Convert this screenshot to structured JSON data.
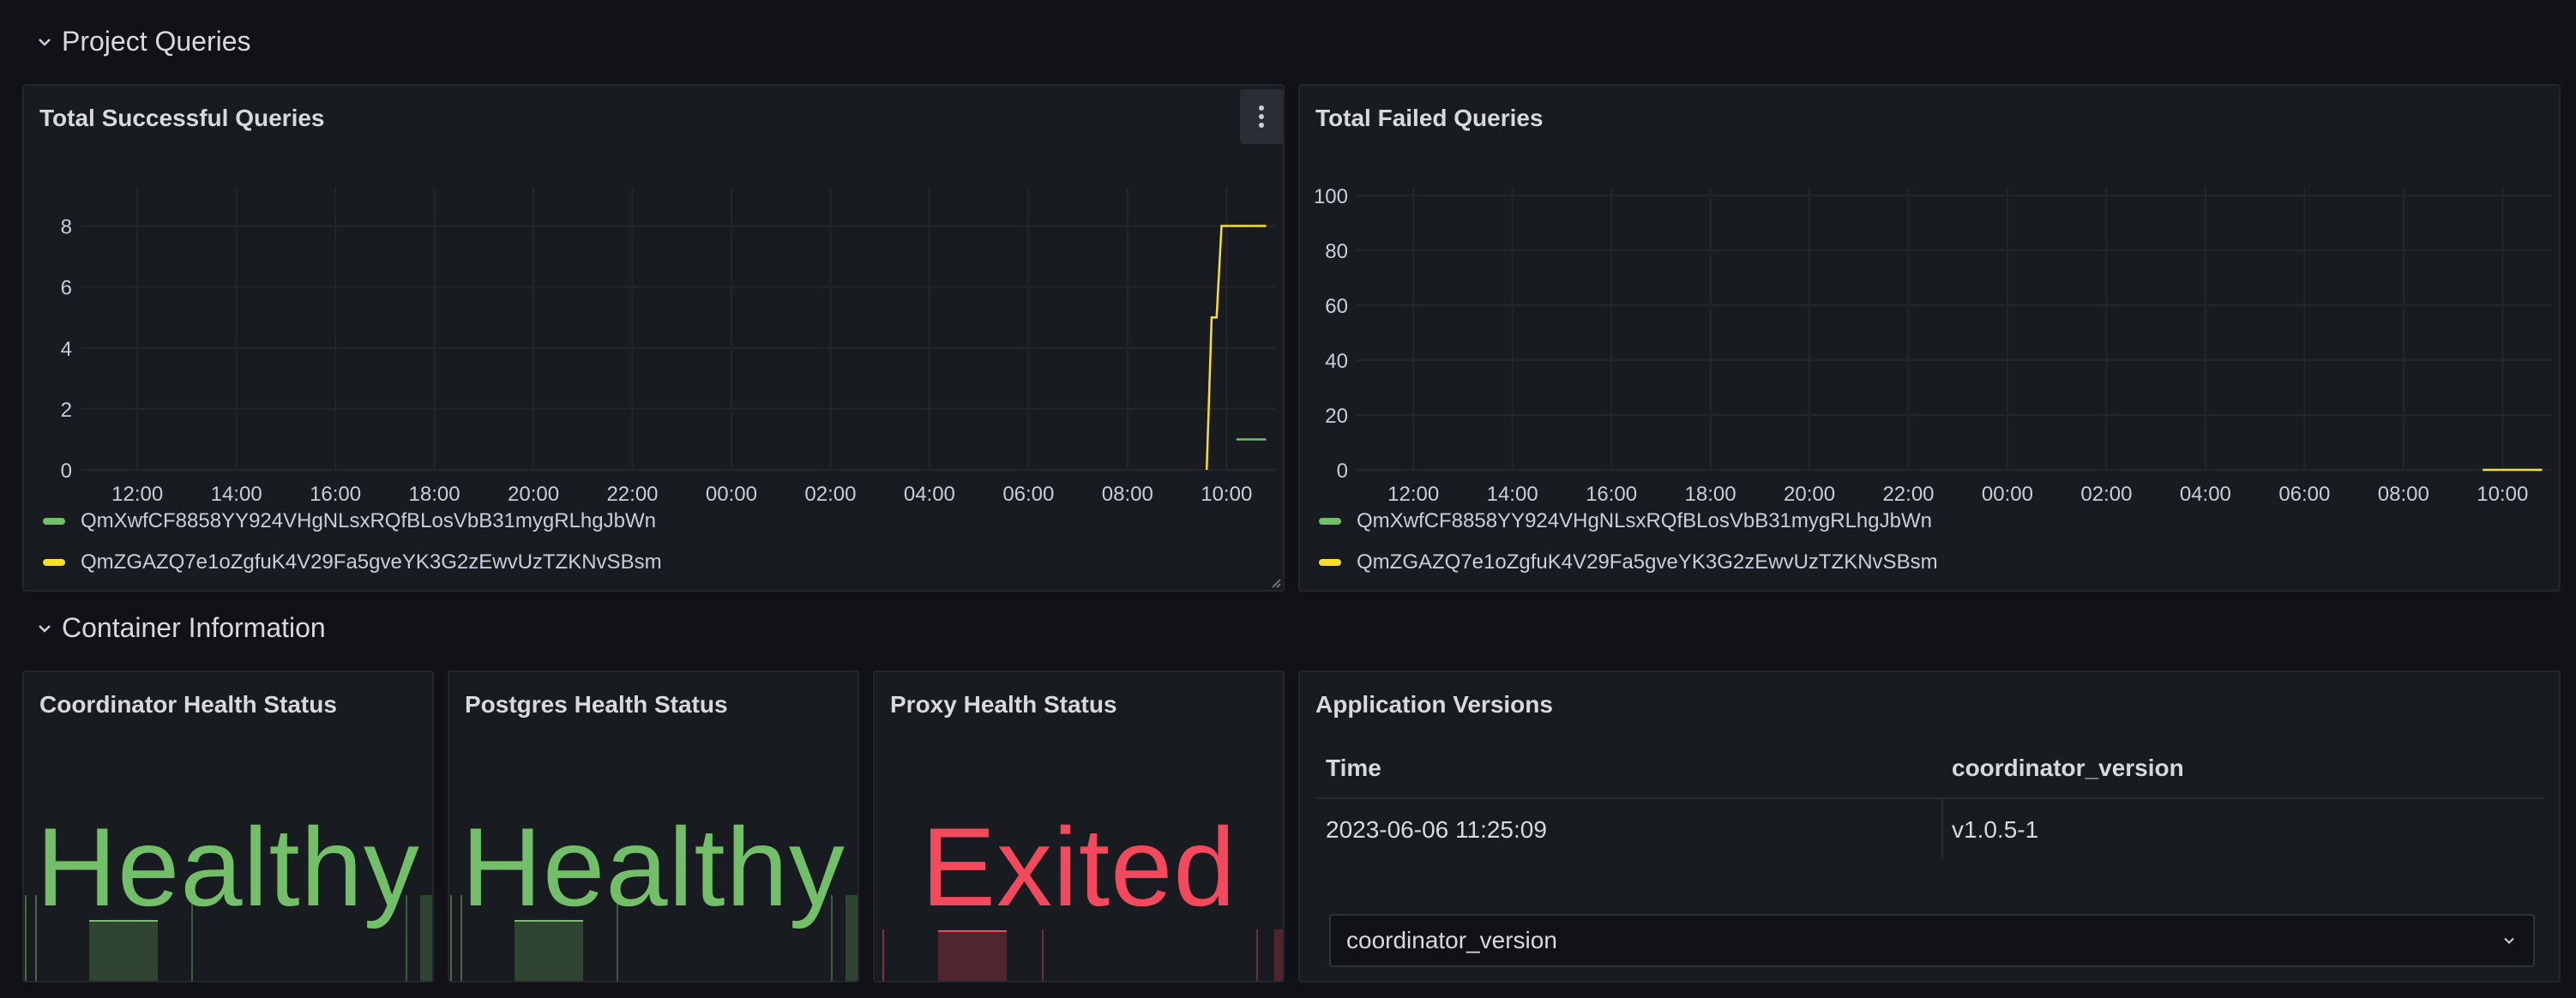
{
  "rows": {
    "project_queries": "Project Queries",
    "container_information": "Container Information"
  },
  "colors": {
    "green": "#73bf69",
    "yellow": "#fade2a",
    "red": "#f2495c"
  },
  "panels": {
    "successful": {
      "title": "Total Successful Queries",
      "legend": [
        {
          "name": "QmXwfCF8858YY924VHgNLsxRQfBLosVbB31mygRLhgJbWn",
          "color": "#73bf69"
        },
        {
          "name": "QmZGAZQ7e1oZgfuK4V29Fa5gveYK3G2zEwvUzTZKNvSBsm",
          "color": "#fade2a"
        }
      ]
    },
    "failed": {
      "title": "Total Failed Queries",
      "legend": [
        {
          "name": "QmXwfCF8858YY924VHgNLsxRQfBLosVbB31mygRLhgJbWn",
          "color": "#73bf69"
        },
        {
          "name": "QmZGAZQ7e1oZgfuK4V29Fa5gveYK3G2zEwvUzTZKNvSBsm",
          "color": "#fade2a"
        }
      ]
    },
    "coordinator": {
      "title": "Coordinator Health Status",
      "value": "Healthy"
    },
    "postgres": {
      "title": "Postgres Health Status",
      "value": "Healthy"
    },
    "proxy": {
      "title": "Proxy Health Status",
      "value": "Exited"
    },
    "versions": {
      "title": "Application Versions",
      "columns": [
        "Time",
        "coordinator_version"
      ],
      "rows": [
        [
          "2023-06-06 11:25:09",
          "v1.0.5-1"
        ]
      ],
      "select_value": "coordinator_version"
    }
  },
  "chart_data": [
    {
      "type": "line",
      "title": "Total Successful Queries",
      "x_ticks": [
        "12:00",
        "14:00",
        "16:00",
        "18:00",
        "20:00",
        "22:00",
        "00:00",
        "02:00",
        "04:00",
        "06:00",
        "08:00",
        "10:00"
      ],
      "y_ticks": [
        0,
        2,
        4,
        6,
        8
      ],
      "ylim": [
        0,
        9
      ],
      "grid": true,
      "legend": "bottom",
      "series": [
        {
          "name": "QmXwfCF8858YY924VHgNLsxRQfBLosVbB31mygRLhgJbWn",
          "color": "#73bf69",
          "x": [
            11.1,
            11.4
          ],
          "y": [
            1,
            1
          ]
        },
        {
          "name": "QmZGAZQ7e1oZgfuK4V29Fa5gveYK3G2zEwvUzTZKNvSBsm",
          "color": "#fade2a",
          "x": [
            10.8,
            10.85,
            10.9,
            10.95,
            11.0,
            11.4
          ],
          "y": [
            0,
            5,
            5,
            8,
            8,
            8
          ]
        }
      ]
    },
    {
      "type": "line",
      "title": "Total Failed Queries",
      "x_ticks": [
        "12:00",
        "14:00",
        "16:00",
        "18:00",
        "20:00",
        "22:00",
        "00:00",
        "02:00",
        "04:00",
        "06:00",
        "08:00",
        "10:00"
      ],
      "y_ticks": [
        0,
        20,
        40,
        60,
        80,
        100
      ],
      "ylim": [
        0,
        100
      ],
      "grid": true,
      "legend": "bottom",
      "series": [
        {
          "name": "QmZGAZQ7e1oZgfuK4V29Fa5gveYK3G2zEwvUzTZKNvSBsm",
          "color": "#fade2a",
          "x": [
            10.8,
            11.4
          ],
          "y": [
            0,
            0
          ]
        }
      ]
    }
  ]
}
